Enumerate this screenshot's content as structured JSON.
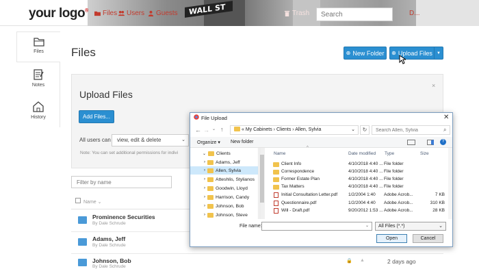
{
  "header": {
    "logo_text": "your logo",
    "logo_mark": "®",
    "nav": [
      {
        "label": "Files",
        "icon": "folder-icon"
      },
      {
        "label": "Users",
        "icon": "users-icon"
      },
      {
        "label": "Guests",
        "icon": "guests-icon"
      },
      {
        "label": "Trash",
        "icon": "trash-icon"
      }
    ],
    "search_placeholder": "Search",
    "user_label": "D...",
    "street_sign": "WALL ST"
  },
  "sidebar": {
    "items": [
      {
        "label": "Files",
        "icon": "folder-outline-icon"
      },
      {
        "label": "Notes",
        "icon": "notes-icon"
      },
      {
        "label": "History",
        "icon": "history-icon"
      }
    ]
  },
  "main": {
    "title": "Files",
    "new_folder_label": "New Folder",
    "upload_label": "Upload Files",
    "upload_panel": {
      "title": "Upload Files",
      "close": "×",
      "add_files_label": "Add Files...",
      "users_can_label": "All users can",
      "permission_value": "view, edit & delete",
      "note": "Note: You can set additional permissions for indivi"
    },
    "filter_placeholder": "Filter by name",
    "list_header": "Name",
    "rows": [
      {
        "title": "Prominence Securities",
        "subtitle": "By Dale Schrude"
      },
      {
        "title": "Adams, Jeff",
        "subtitle": "By Dale Schrude"
      },
      {
        "title": "Johnson, Bob",
        "subtitle": "By Dale Schrude",
        "modified": "2 days ago"
      }
    ]
  },
  "dialog": {
    "title": "File Upload",
    "close": "✕",
    "path": [
      "My Cabinets",
      "Clients",
      "Allen, Sylvia"
    ],
    "path_prefix": "«",
    "search_placeholder": "Search Allen, Sylvia",
    "organize_label": "Organize ▾",
    "new_folder_label": "New folder",
    "tree": [
      {
        "label": "Clients",
        "level": 0
      },
      {
        "label": "Adams, Jeff",
        "level": 1
      },
      {
        "label": "Allen, Sylvia",
        "level": 1,
        "selected": true
      },
      {
        "label": "Atteshlis, Stylianos",
        "level": 1
      },
      {
        "label": "Goodwin, Lloyd",
        "level": 1
      },
      {
        "label": "Harrison, Candy",
        "level": 1
      },
      {
        "label": "Johnson, Bob",
        "level": 1
      },
      {
        "label": "Johnson, Steve",
        "level": 1
      }
    ],
    "columns": [
      "Name",
      "Date modified",
      "Type",
      "Size"
    ],
    "files": [
      {
        "name": "Client Info",
        "date": "4/10/2018 4:40 ...",
        "type": "File folder",
        "size": "",
        "kind": "folder"
      },
      {
        "name": "Correspondence",
        "date": "4/10/2018 4:40 ...",
        "type": "File folder",
        "size": "",
        "kind": "folder"
      },
      {
        "name": "Former Estate Plan",
        "date": "4/10/2018 4:40 ...",
        "type": "File folder",
        "size": "",
        "kind": "folder"
      },
      {
        "name": "Tax Matters",
        "date": "4/10/2018 4:40 ...",
        "type": "File folder",
        "size": "",
        "kind": "folder"
      },
      {
        "name": "Initial Consultation Letter.pdf",
        "date": "1/2/2004 1:40",
        "type": "Adobe Acrob...",
        "size": "7 KB",
        "kind": "pdf"
      },
      {
        "name": "Questionnaire.pdf",
        "date": "1/2/2004 4:40",
        "type": "Adobe Acrob...",
        "size": "310 KB",
        "kind": "pdf"
      },
      {
        "name": "Will - Draft.pdf",
        "date": "9/20/2012 1:53 ...",
        "type": "Adobe Acrob...",
        "size": "28 KB",
        "kind": "pdf"
      }
    ],
    "filename_label": "File name:",
    "filetype_value": "All Files (*.*)",
    "open_label": "Open",
    "cancel_label": "Cancel"
  }
}
